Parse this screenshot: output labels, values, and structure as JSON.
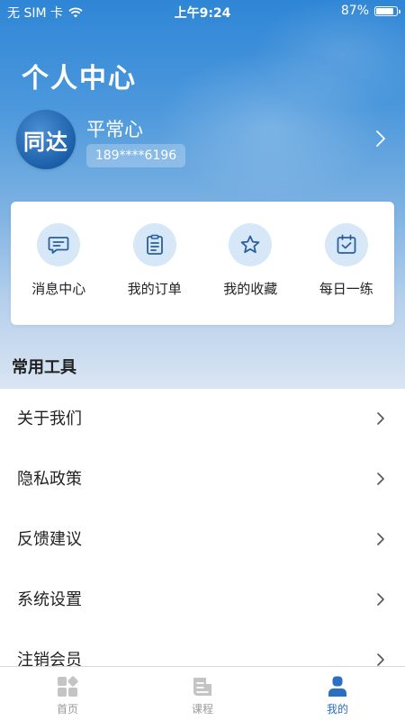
{
  "status_bar": {
    "carrier": "无 SIM 卡",
    "time": "上午9:24",
    "battery_percent": "87%",
    "battery_level": 0.87
  },
  "header": {
    "title": "个人中心"
  },
  "profile": {
    "avatar_text": "同达",
    "name": "平常心",
    "phone": "189****6196"
  },
  "quick_actions": [
    {
      "label": "消息中心",
      "icon": "message-icon"
    },
    {
      "label": "我的订单",
      "icon": "clipboard-icon"
    },
    {
      "label": "我的收藏",
      "icon": "star-icon"
    },
    {
      "label": "每日一练",
      "icon": "calendar-check-icon"
    }
  ],
  "tools": {
    "title": "常用工具",
    "items": [
      {
        "label": "关于我们"
      },
      {
        "label": "隐私政策"
      },
      {
        "label": "反馈建议"
      },
      {
        "label": "系统设置"
      },
      {
        "label": "注销会员"
      }
    ]
  },
  "tabbar": {
    "tabs": [
      {
        "label": "首页",
        "icon": "home-grid-icon",
        "active": false
      },
      {
        "label": "课程",
        "icon": "course-icon",
        "active": false
      },
      {
        "label": "我的",
        "icon": "user-icon",
        "active": true
      }
    ]
  },
  "colors": {
    "accent": "#2a6fc1",
    "icon_bg": "#d6e8f8",
    "icon_stroke": "#2a5f9e"
  }
}
